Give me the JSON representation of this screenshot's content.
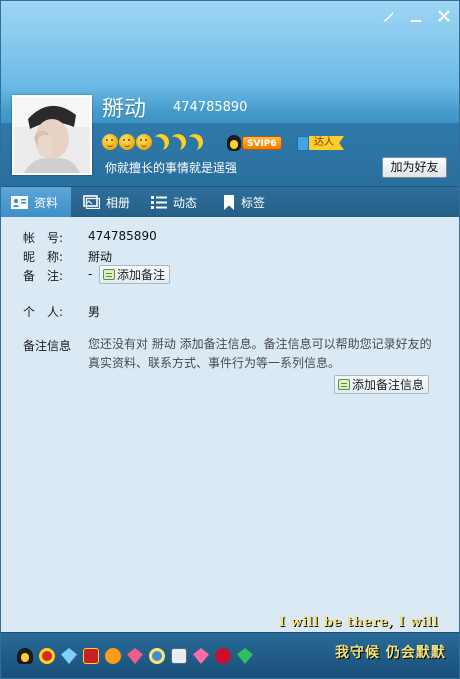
{
  "window": {
    "skin_icon": "brush-icon",
    "minimize_icon": "minimize-icon",
    "close_icon": "close-icon"
  },
  "profile": {
    "nickname": "掰动",
    "qq_number": "474785890",
    "signature": "你就擅长的事情就是逞强",
    "add_friend_label": "加为好友",
    "vip_label": "SVIP6",
    "daren_label": "达人",
    "level_icons": [
      "sun",
      "sun",
      "sun",
      "moon",
      "moon",
      "moon"
    ]
  },
  "tabs": [
    {
      "label": "资料",
      "icon": "profile-card-icon",
      "active": true
    },
    {
      "label": "相册",
      "icon": "photo-album-icon",
      "active": false
    },
    {
      "label": "动态",
      "icon": "feed-list-icon",
      "active": false
    },
    {
      "label": "标签",
      "icon": "bookmark-icon",
      "active": false
    }
  ],
  "info": {
    "account_label": "帐　号:",
    "account_value": "474785890",
    "nickname_label": "昵　称:",
    "nickname_value": "掰动",
    "remark_label": "备　注:",
    "remark_value": "-",
    "add_remark_label": "添加备注",
    "personal_label": "个　人:",
    "personal_value": "男",
    "remark_info_label": "备注信息",
    "remark_info_text": "您还没有对 掰动 添加备注信息。备注信息可以帮助您记录好友的真实资料、联系方式、事件行为等一系列信息。",
    "add_remark_info_label": "添加备注信息"
  },
  "bottom": {
    "marquee_en": "I will be there, I will",
    "marquee_cn": "我守候 仍会默默",
    "badge_icons": [
      "qq-penguin-icon",
      "red-envelope-icon",
      "diamond-icon",
      "red-badge-icon",
      "sun-badge-icon",
      "pink-diamond-icon",
      "blue-badge-icon",
      "white-badge-icon",
      "pink-gem-icon",
      "red-gem-icon",
      "green-diamond-icon"
    ]
  }
}
